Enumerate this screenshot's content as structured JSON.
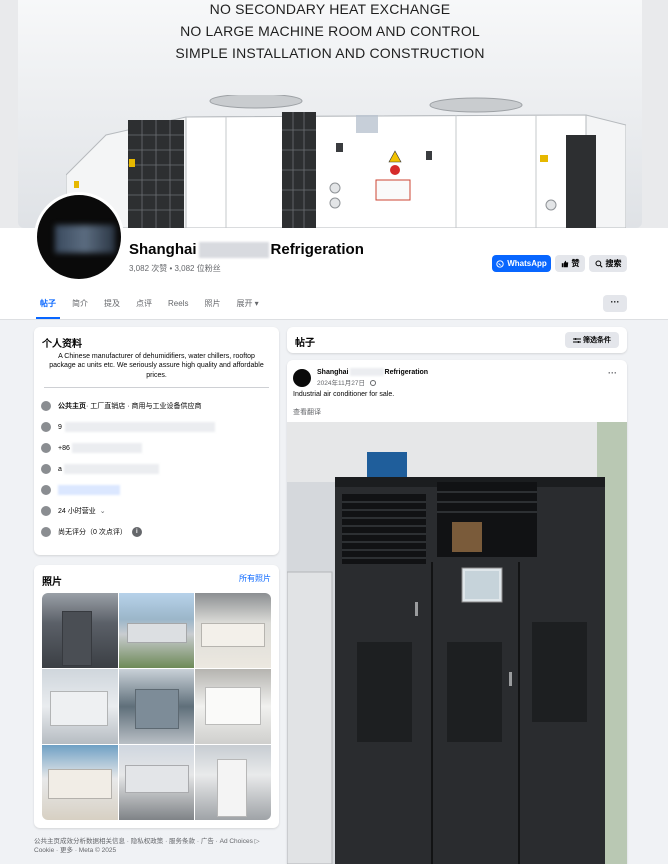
{
  "cover": {
    "lines": [
      "NO SECONDARY HEAT EXCHANGE",
      "NO LARGE MACHINE ROOM AND CONTROL",
      "SIMPLE INSTALLATION AND CONSTRUCTION"
    ]
  },
  "profile": {
    "name_prefix": "Shanghai",
    "name_suffix": "Refrigeration",
    "stats": "3,082 次赞 • 3,082 位粉丝",
    "buttons": {
      "whatsapp": "WhatsApp",
      "like": "赞",
      "search": "搜索"
    }
  },
  "tabs": [
    {
      "label": "帖子",
      "active": true
    },
    {
      "label": "简介"
    },
    {
      "label": "提及"
    },
    {
      "label": "点评"
    },
    {
      "label": "Reels"
    },
    {
      "label": "照片"
    },
    {
      "label": "展开 ▾"
    }
  ],
  "tabs_more": "···",
  "intro": {
    "title": "个人资料",
    "bio": "A Chinese manufacturer of dehumidifiers, water chillers, rooftop package ac units etc. We seriously assure high quality and affordable prices.",
    "category_label": "公共主页",
    "category_value": " · 工厂直销店 · 商用与工业设备供应商",
    "address_prefix": "9",
    "phone_prefix": "+86",
    "email_prefix": "a",
    "hours": "24 小时营业",
    "hours_caret": "⌄",
    "rating": "尚无评分（0 次点评）",
    "rating_info": "i"
  },
  "photos": {
    "title": "照片",
    "see_all": "所有照片"
  },
  "footer": {
    "line1": "公共主页成效分析数据相关信息 · 隐私权政策 · 服务条款 · 广告 · Ad Choices ▷",
    "line2": "Cookie · 更多 · Meta © 2025"
  },
  "posts": {
    "title": "帖子",
    "filter": "筛选条件"
  },
  "post": {
    "name_prefix": "Shanghai",
    "name_suffix": "Refrigeration",
    "date": "2024年11月27日",
    "more": "···",
    "text": "Industrial air conditioner for sale.",
    "translate": "查看翻译"
  },
  "colors": {
    "accent": "#0866ff",
    "background": "#f0f2f5",
    "green": "#31a24c"
  }
}
